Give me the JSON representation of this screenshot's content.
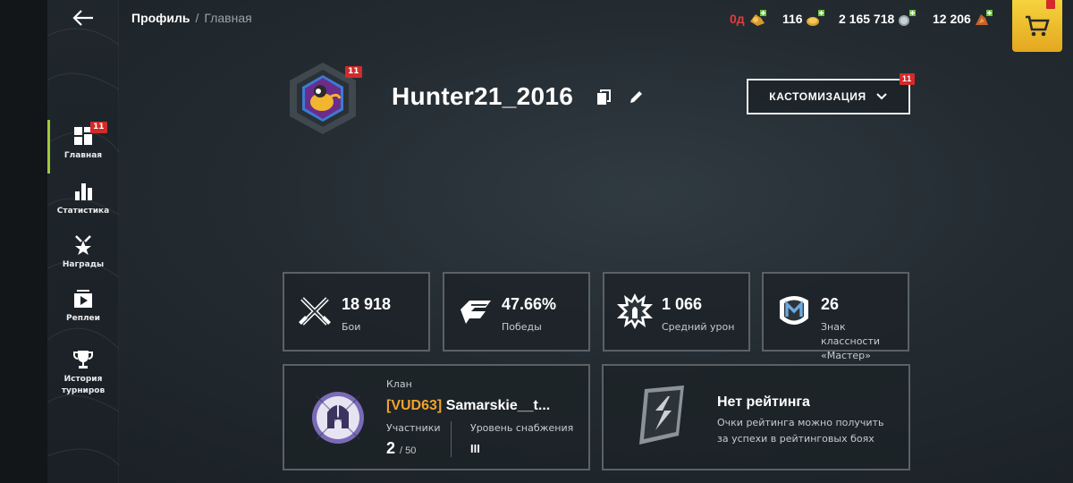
{
  "breadcrumb": {
    "current": "Профиль",
    "separator": "/",
    "page": "Главная"
  },
  "currencies": [
    {
      "value": "0д",
      "icon": "premium-time-icon",
      "color": "#e63b3b"
    },
    {
      "value": "116",
      "icon": "gold-icon",
      "color": "#ffffff"
    },
    {
      "value": "2 165 718",
      "icon": "credits-icon",
      "color": "#ffffff"
    },
    {
      "value": "12 206",
      "icon": "free-xp-icon",
      "color": "#ffffff"
    }
  ],
  "sidebar": {
    "items": [
      {
        "label": "Главная",
        "icon": "home-grid-icon",
        "badge": "11",
        "active": true
      },
      {
        "label": "Статистика",
        "icon": "bar-chart-icon"
      },
      {
        "label": "Награды",
        "icon": "award-star-icon"
      },
      {
        "label": "Реплеи",
        "icon": "replay-play-icon"
      },
      {
        "label": "История турниров",
        "icon": "trophy-icon"
      }
    ]
  },
  "profile": {
    "username": "Hunter21_2016",
    "avatar_badge": "11",
    "customize_label": "КАСТОМИЗАЦИЯ",
    "customize_badge": "11"
  },
  "stats": [
    {
      "value": "18 918",
      "label": "Бои",
      "icon": "crossed-swords-icon"
    },
    {
      "value": "47.66%",
      "label": "Победы",
      "icon": "victory-wing-icon"
    },
    {
      "value": "1 066",
      "label": "Средний урон",
      "icon": "explosion-shell-icon"
    },
    {
      "value": "26",
      "label": "Знак классности «Мастер»",
      "icon": "mastery-badge-icon"
    }
  ],
  "clan": {
    "caption": "Клан",
    "tag": "[VUD63]",
    "name": "Samarskie__t...",
    "members_label": "Участники",
    "members_value": "2",
    "members_max": "/ 50",
    "supply_label": "Уровень снабжения",
    "supply_value": "III"
  },
  "rating": {
    "title": "Нет рейтинга",
    "description": "Очки рейтинга можно получить за успехи в рейтинговых боях"
  },
  "colors": {
    "accent_green": "#9fc93a",
    "badge_red": "#d32a2a",
    "clan_tag": "#f0a32c",
    "shop_yellow": "#f5d33d"
  }
}
